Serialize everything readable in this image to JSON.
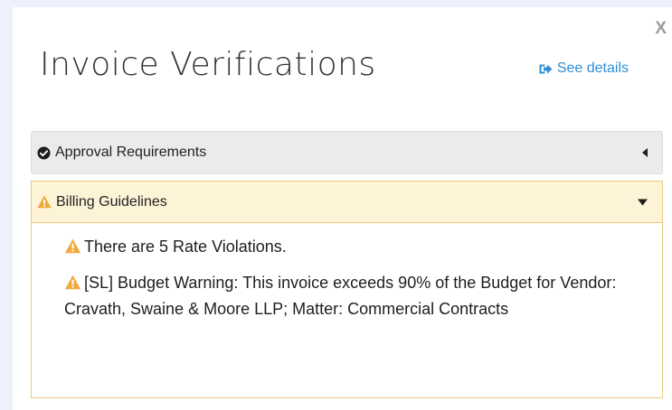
{
  "modal": {
    "close_label": "X",
    "title": "Invoice Verifications",
    "see_details_label": "See details"
  },
  "sections": {
    "approval": {
      "label": "Approval Requirements",
      "icon": "check-circle-icon",
      "expanded": false
    },
    "billing": {
      "label": "Billing Guidelines",
      "icon": "warning-icon",
      "expanded": true,
      "items": [
        "There are 5 Rate Violations.",
        "[SL] Budget Warning: This invoice exceeds 90% of the Budget for Vendor: Cravath, Swaine & Moore LLP; Matter: Commercial Contracts"
      ]
    }
  },
  "colors": {
    "accent_link": "#2e8fd6",
    "warning": "#f0a93b",
    "billing_bg": "#fdf3d6",
    "billing_border": "#edc97a",
    "approval_bg": "#ebebeb"
  }
}
